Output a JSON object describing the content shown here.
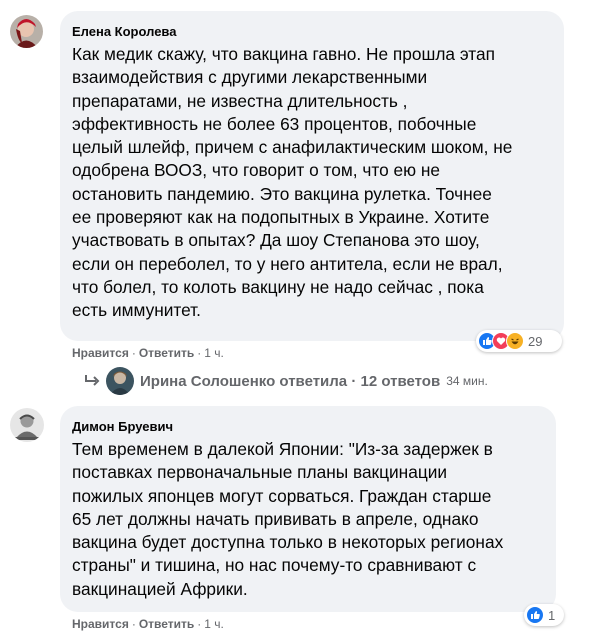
{
  "comments": [
    {
      "author": "Елена Королева",
      "lines": [
        "Как медик скажу, что вакцина гавно. Не прошла этап",
        "взаимодействия с другими лекарственными",
        "препаратами, не известна длительность ,",
        "эффективность не более 63 процентов, побочные",
        "целый шлейф, причем с анафилактическим шоком, не",
        "одобрена ВООЗ, что говорит о том, что ею не",
        "остановить пандемию. Это вакцина рулетка. Точнее",
        "ее проверяют как на подопытных в Украине. Хотите",
        "участвовать в опытах? Да шоу Степанова это шоу,",
        "если он переболел, то у него антитела, если не врал,",
        "что болел, то колоть вакцину не надо сейчас , пока",
        "есть иммунитет."
      ],
      "like_label": "Нравится",
      "reply_label": "Ответить",
      "time": "1 ч.",
      "reaction_count": "29",
      "reactions": [
        "like-icon",
        "love-icon",
        "haha-icon"
      ]
    },
    {
      "author": "Димон Бруевич",
      "lines": [
        "Тем временем в далекой Японии: \"Из-за задержек в",
        "поставках первоначальные планы вакцинации",
        "пожилых японцев могут сорваться. Граждан старше",
        "65 лет должны начать прививать в апреле, однако",
        "вакцина будет доступна только в некоторых регионах",
        "страны\" и тишина, но нас почему-то сравнивают с",
        "вакцинацией Африки."
      ],
      "like_label": "Нравится",
      "reply_label": "Ответить",
      "time": "1 ч.",
      "reaction_count": "1",
      "reactions": [
        "like-icon"
      ]
    }
  ],
  "replies_summary": {
    "author": "Ирина Солошенко",
    "action": "ответила",
    "count_text": "12 ответов",
    "time": "34 мин.",
    "separator": "·"
  },
  "colors": {
    "bubble": "#f0f2f5",
    "muted": "#65676b",
    "like": "#1877f2",
    "love": "#f33e58",
    "haha": "#f7b125"
  }
}
